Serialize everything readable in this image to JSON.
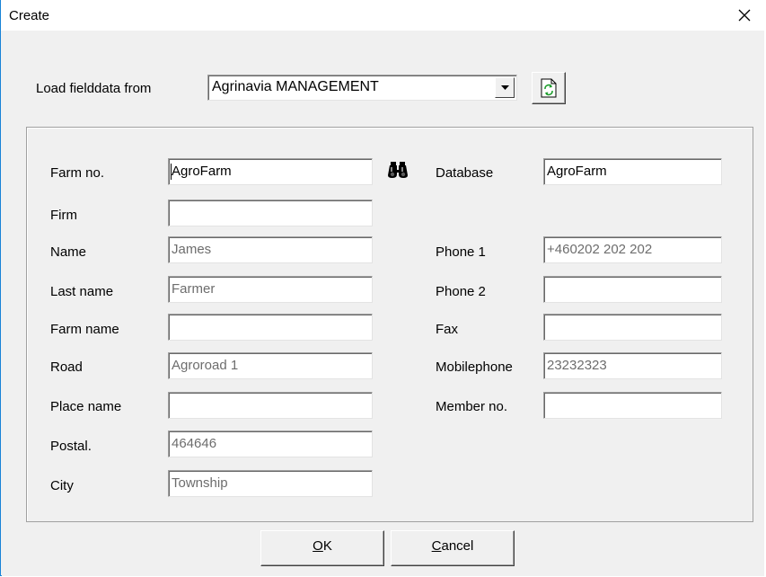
{
  "window": {
    "title": "Create"
  },
  "load": {
    "label": "Load fielddata from",
    "selected": "Agrinavia MANAGEMENT"
  },
  "form": {
    "farm_no": {
      "label": "Farm no.",
      "value": "AgroFarm"
    },
    "firm": {
      "label": "Firm",
      "value": ""
    },
    "name": {
      "label": "Name",
      "value": "James"
    },
    "last_name": {
      "label": "Last name",
      "value": "Farmer"
    },
    "farm_name": {
      "label": "Farm name",
      "value": ""
    },
    "road": {
      "label": "Road",
      "value": "Agroroad 1"
    },
    "place_name": {
      "label": "Place name",
      "value": ""
    },
    "postal": {
      "label": "Postal.",
      "value": "464646"
    },
    "city": {
      "label": "City",
      "value": "Township"
    },
    "database": {
      "label": "Database",
      "value": "AgroFarm"
    },
    "phone1": {
      "label": "Phone 1",
      "value": "+460202 202 202"
    },
    "phone2": {
      "label": "Phone 2",
      "value": ""
    },
    "fax": {
      "label": "Fax",
      "value": ""
    },
    "mobilephone": {
      "label": "Mobilephone",
      "value": "23232323"
    },
    "member_no": {
      "label": "Member no.",
      "value": ""
    }
  },
  "buttons": {
    "ok": {
      "mnemonic": "O",
      "rest": "K"
    },
    "cancel": {
      "mnemonic": "C",
      "rest": "ancel"
    }
  },
  "icons": {
    "close": "close-icon",
    "refresh": "refresh-icon",
    "search": "binoculars-icon",
    "dropdown": "dropdown-arrow-icon"
  }
}
